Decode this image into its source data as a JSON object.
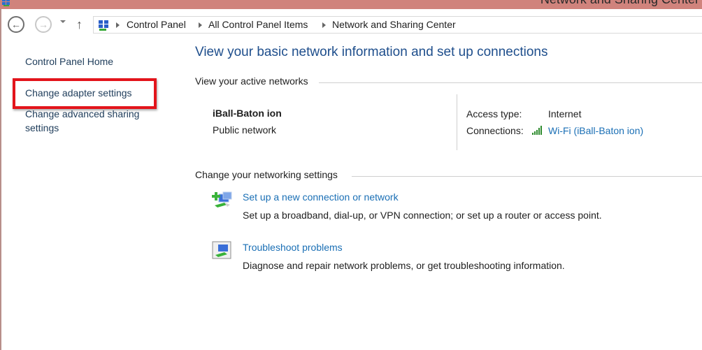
{
  "window": {
    "title": "Network and Sharing Center",
    "app_icon": "network-icon",
    "titlebar_color": "#d0837c"
  },
  "navigation": {
    "back_icon": "back-arrow-icon",
    "forward_icon": "forward-arrow-icon",
    "recent_icon": "chevron-down-icon",
    "up_icon": "up-arrow-icon",
    "breadcrumbs": [
      "Control Panel",
      "All Control Panel Items",
      "Network and Sharing Center"
    ]
  },
  "sidebar": {
    "items": [
      {
        "label": "Control Panel Home"
      },
      {
        "label": "Change adapter settings",
        "highlighted": true
      },
      {
        "label": "Change advanced sharing settings",
        "line1": "Change advanced sharing",
        "line2": "settings"
      }
    ],
    "highlight_color": "#e3141b"
  },
  "main": {
    "title": "View your basic network information and set up connections",
    "active_networks": {
      "header": "View your active networks",
      "network_name": "iBall-Baton ion",
      "network_type": "Public network",
      "access_type_label": "Access type:",
      "access_type_value": "Internet",
      "connections_label": "Connections:",
      "connections_value": "Wi-Fi (iBall-Baton ion)",
      "connection_icon": "wifi-signal-icon"
    },
    "settings": {
      "header": "Change your networking settings",
      "tasks": [
        {
          "icon": "new-connection-icon",
          "link": "Set up a new connection or network",
          "description": "Set up a broadband, dial-up, or VPN connection; or set up a router or access point."
        },
        {
          "icon": "troubleshoot-icon",
          "link": "Troubleshoot problems",
          "description": "Diagnose and repair network problems, or get troubleshooting information."
        }
      ]
    },
    "link_color": "#1a6fb5",
    "title_color": "#1e4e8c"
  }
}
